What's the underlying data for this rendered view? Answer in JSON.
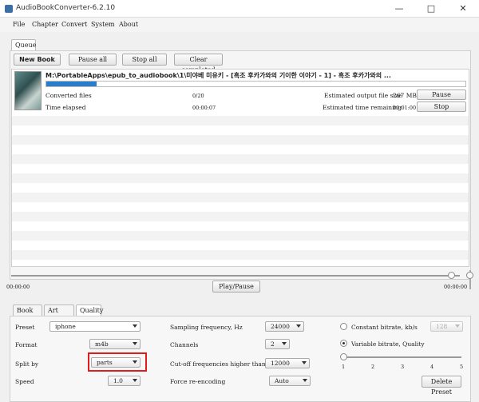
{
  "window": {
    "title": "AudioBookConverter-6.2.10"
  },
  "menu": {
    "items": [
      "File",
      "Chapter",
      "Convert",
      "System",
      "About"
    ]
  },
  "queue_tab": "Queue",
  "toolbar": {
    "new_book": "New Book",
    "pause_all": "Pause all",
    "stop_all": "Stop all",
    "clear_completed": "Clear completed"
  },
  "job": {
    "title": "M:\\PortableApps\\epub_to_audiobook\\1\\미야베 미유키 - [흑조 후카가와의 기이한 이야기 - 1] - 흑조 후카가와의 ...",
    "progress_pct": 12,
    "converted_files_label": "Converted files",
    "converted_files_value": "0/20",
    "time_elapsed_label": "Time elapsed",
    "time_elapsed_value": "00:00:07",
    "est_size_label": "Estimated output file size",
    "est_size_value": "267 MB",
    "est_time_label": "Estimated time remaining",
    "est_time_value": "00:01:00",
    "pause_button": "Pause",
    "stop_button": "Stop"
  },
  "player": {
    "time_left": "00:00:00",
    "time_right": "00:00:00",
    "play_pause": "Play/Pause",
    "position_pct": 98
  },
  "bottom_tabs": [
    "Book Info",
    "Art Work",
    "Quality"
  ],
  "quality": {
    "preset_label": "Preset",
    "preset_value": "iphone",
    "format_label": "Format",
    "format_value": "m4b",
    "split_label": "Split by",
    "split_value": "parts",
    "speed_label": "Speed",
    "speed_value": "1.0",
    "sampling_label": "Sampling frequency, Hz",
    "sampling_value": "24000",
    "channels_label": "Channels",
    "channels_value": "2",
    "cutoff_label": "Cut-off frequencies higher than",
    "cutoff_value": "12000",
    "force_label": "Force re-encoding",
    "force_value": "Auto",
    "cbr_label": "Constant bitrate, kb/s",
    "cbr_value": "128",
    "vbr_label": "Variable bitrate, Quality",
    "vbr_ticks": [
      "1",
      "2",
      "3",
      "4",
      "5"
    ],
    "vbr_level": 1,
    "delete_preset": "Delete Preset"
  },
  "colors": {
    "progress": "#2a7dc8",
    "highlight": "#e01c1c"
  }
}
